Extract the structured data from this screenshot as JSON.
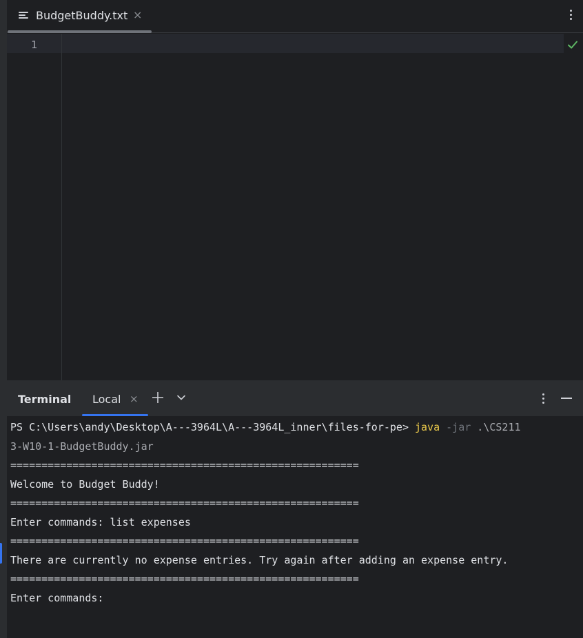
{
  "editor": {
    "tab_title": "BudgetBuddy.txt",
    "tab_close": "×",
    "line_numbers": [
      "1"
    ],
    "status_icon": "check-icon"
  },
  "terminal": {
    "title": "Terminal",
    "tab_label": "Local",
    "tab_close": "×",
    "lines": {
      "prompt": "PS C:\\Users\\andy\\Desktop\\A---3964L\\A---3964L_inner\\files-for-pe> ",
      "cmd_java": "java",
      "cmd_flag": " -jar",
      "cmd_path": " .\\CS211",
      "cmd_path_cont": "3-W10-1-BudgetBuddy.jar",
      "sep1": "========================================================",
      "welcome": "Welcome to Budget Buddy!",
      "sep2": "========================================================",
      "enter1": "Enter commands: list expenses",
      "sep3": "========================================================",
      "response": "There are currently no expense entries. Try again after adding an expense entry.",
      "sep4": "========================================================",
      "enter2": "Enter commands:"
    }
  },
  "colors": {
    "background": "#1e1f22",
    "panel": "#2b2d30",
    "accent": "#3574f0",
    "command_keyword": "#e8c74a",
    "success": "#5fb865"
  }
}
